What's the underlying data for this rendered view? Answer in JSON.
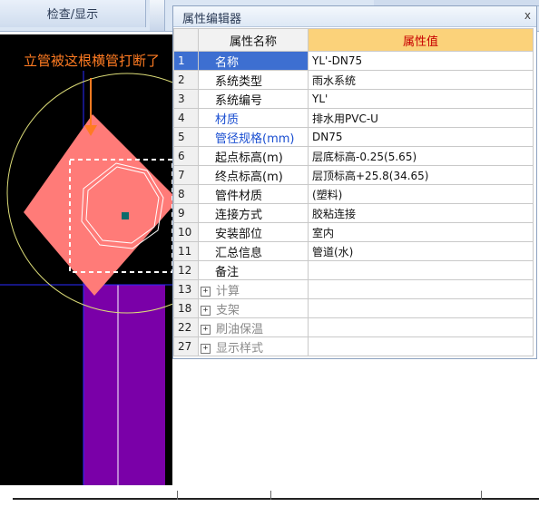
{
  "toolbar": {
    "check_display_label": "检查/显示"
  },
  "canvas": {
    "annotation": "立管被这根横管打断了",
    "colors": {
      "background": "#000000",
      "riser": "#7a00a8",
      "elbow": "#ff7b78",
      "circle": "#dcdc78",
      "gridline": "#2a2aff",
      "accent": "#ff7b22"
    }
  },
  "panel": {
    "title": "属性编辑器",
    "close_label": "x",
    "headers": {
      "name": "属性名称",
      "value": "属性值"
    },
    "rows": [
      {
        "index": "1",
        "name": "名称",
        "value": "YL'-DN75",
        "style": "blue",
        "selected": true
      },
      {
        "index": "2",
        "name": "系统类型",
        "value": "雨水系统"
      },
      {
        "index": "3",
        "name": "系统编号",
        "value": "YL'"
      },
      {
        "index": "4",
        "name": "材质",
        "value": "排水用PVC-U",
        "style": "blue"
      },
      {
        "index": "5",
        "name": "管径规格(mm)",
        "value": "DN75",
        "style": "blue"
      },
      {
        "index": "6",
        "name": "起点标高(m)",
        "value": "层底标高-0.25(5.65)"
      },
      {
        "index": "7",
        "name": "终点标高(m)",
        "value": "层顶标高+25.8(34.65)"
      },
      {
        "index": "8",
        "name": "管件材质",
        "value": "(塑料)"
      },
      {
        "index": "9",
        "name": "连接方式",
        "value": "胶粘连接"
      },
      {
        "index": "10",
        "name": "安装部位",
        "value": "室内"
      },
      {
        "index": "11",
        "name": "汇总信息",
        "value": "管道(水)"
      },
      {
        "index": "12",
        "name": "备注",
        "value": ""
      },
      {
        "index": "13",
        "name": "计算",
        "value": "",
        "group": true
      },
      {
        "index": "18",
        "name": "支架",
        "value": "",
        "group": true
      },
      {
        "index": "22",
        "name": "刷油保温",
        "value": "",
        "group": true
      },
      {
        "index": "27",
        "name": "显示样式",
        "value": "",
        "group": true
      }
    ]
  }
}
